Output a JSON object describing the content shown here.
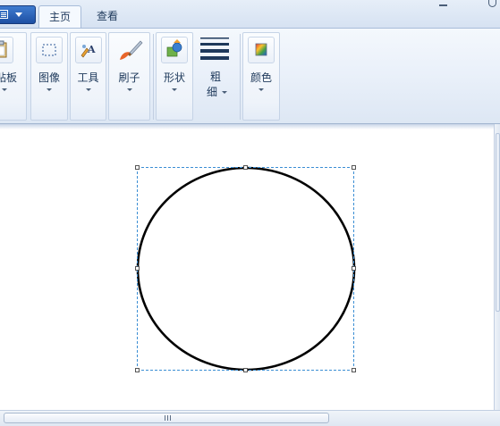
{
  "tabs": {
    "home_label": "主页",
    "view_label": "查看"
  },
  "ribbon": {
    "clipboard_label": "剪贴板",
    "image_label": "图像",
    "tools_label": "工具",
    "brushes_label": "刷子",
    "shapes_label": "形状",
    "size_label_line1": "粗",
    "size_label_line2": "细",
    "colors_label": "颜色"
  },
  "icons": {
    "app_menu": "app-menu-icon",
    "clipboard": "clipboard-icon",
    "image_select": "select-rectangle-icon",
    "tools": "tools-icon",
    "brush": "brush-icon",
    "shapes": "shapes-icon",
    "size": "line-size-icon",
    "colors": "color-palette-icon"
  },
  "canvas": {
    "shape": "ellipse",
    "stroke_color": "#000000",
    "selection_color": "#3b8ed4"
  },
  "colors": {
    "ribbon_bg": "#e8eff9",
    "accent": "#1d4fa3",
    "text": "#1e395b"
  }
}
